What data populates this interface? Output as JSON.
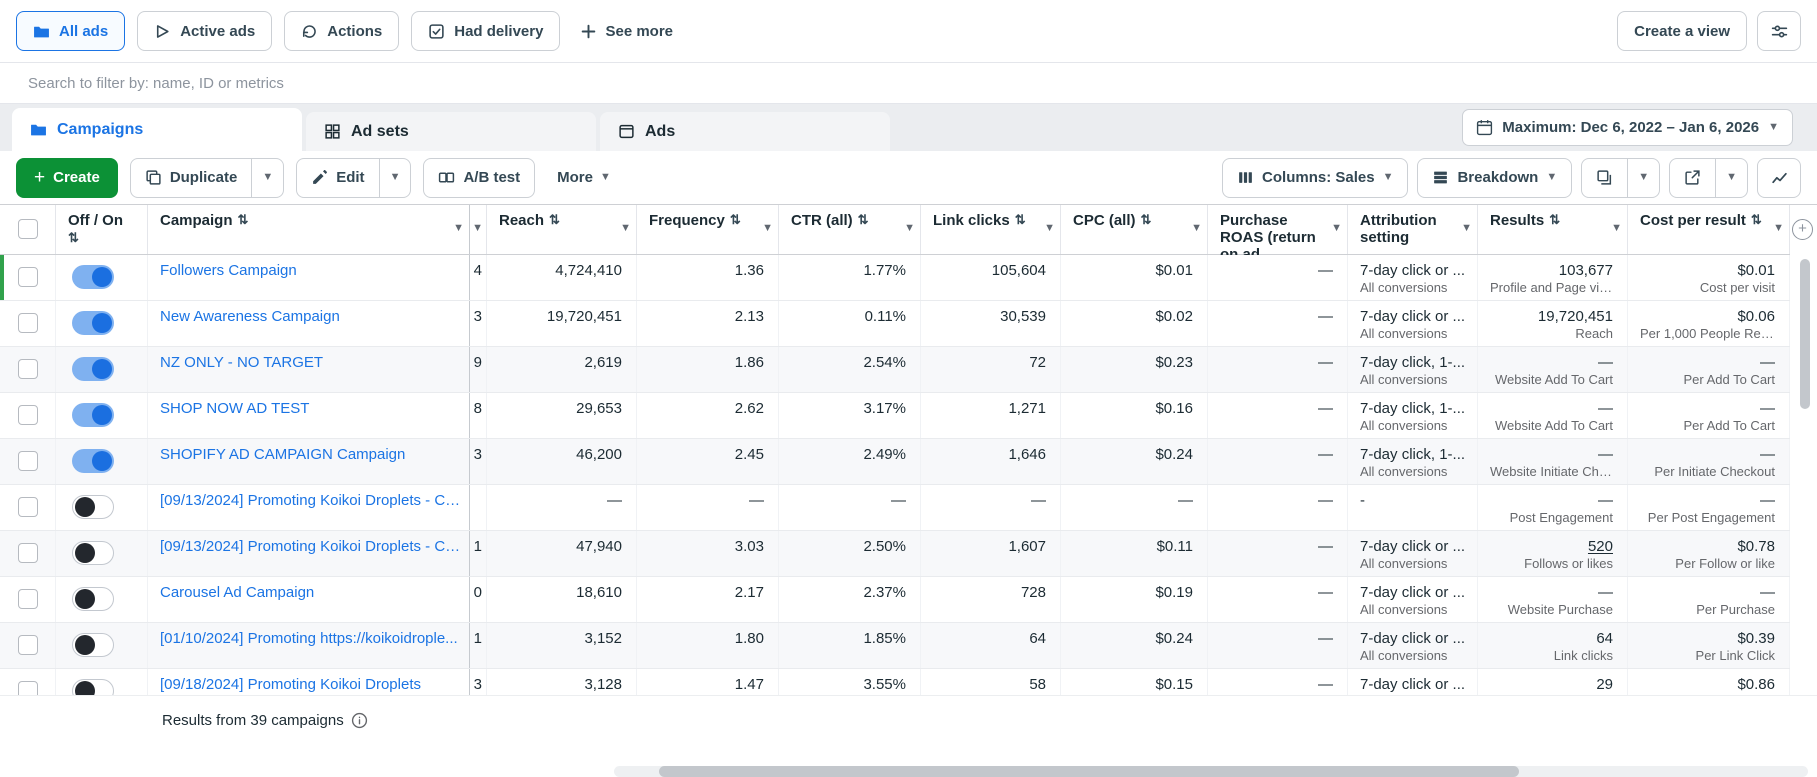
{
  "colors": {
    "accent_blue": "#1b74e4",
    "create_green": "#0c9136",
    "link_blue": "#1b74e4",
    "indicator_green": "#31a24c"
  },
  "filter_bar": {
    "pills": [
      {
        "label": "All ads",
        "selected": true
      },
      {
        "label": "Active ads",
        "selected": false
      },
      {
        "label": "Actions",
        "selected": false
      },
      {
        "label": "Had delivery",
        "selected": false
      }
    ],
    "see_more": "See more",
    "create_view": "Create a view"
  },
  "search": {
    "placeholder": "Search to filter by: name, ID or metrics"
  },
  "tabs": [
    {
      "label": "Campaigns",
      "active": true
    },
    {
      "label": "Ad sets",
      "active": false
    },
    {
      "label": "Ads",
      "active": false
    }
  ],
  "date_range": {
    "label": "Maximum: Dec 6, 2022 – Jan 6, 2026"
  },
  "toolbar": {
    "create": "Create",
    "duplicate": "Duplicate",
    "edit": "Edit",
    "ab_test": "A/B test",
    "more": "More",
    "columns": "Columns: Sales",
    "breakdown": "Breakdown"
  },
  "table": {
    "headers": {
      "off_on": "Off / On",
      "campaign": "Campaign",
      "reach": "Reach",
      "frequency": "Frequency",
      "ctr": "CTR (all)",
      "link_clicks": "Link clicks",
      "cpc": "CPC (all)",
      "purchase_roas": "Purchase ROAS (return on ad...",
      "attribution": "Attribution setting",
      "results": "Results",
      "cost_per_result": "Cost per result"
    },
    "rows": [
      {
        "name": "Followers Campaign",
        "on": true,
        "updated": true,
        "frag": "4",
        "reach": "4,724,410",
        "frequency": "1.36",
        "ctr": "1.77%",
        "link_clicks": "105,604",
        "cpc": "$0.01",
        "roas": "—",
        "attribution": "7-day click or ...",
        "attribution_sub": "All conversions",
        "results": "103,677",
        "results_sub": "Profile and Page visits",
        "cost": "$0.01",
        "cost_sub": "Cost per visit"
      },
      {
        "name": "New Awareness Campaign",
        "on": true,
        "frag": "3",
        "reach": "19,720,451",
        "frequency": "2.13",
        "ctr": "0.11%",
        "link_clicks": "30,539",
        "cpc": "$0.02",
        "roas": "—",
        "attribution": "7-day click or ...",
        "attribution_sub": "All conversions",
        "results": "19,720,451",
        "results_sub": "Reach",
        "cost": "$0.06",
        "cost_sub": "Per 1,000 People Rea..."
      },
      {
        "name": "NZ ONLY - NO TARGET",
        "on": true,
        "frag": "9",
        "reach": "2,619",
        "frequency": "1.86",
        "ctr": "2.54%",
        "link_clicks": "72",
        "cpc": "$0.23",
        "roas": "—",
        "attribution": "7-day click, 1-...",
        "attribution_sub": "All conversions",
        "results": "—",
        "results_sub": "Website Add To Cart",
        "cost": "—",
        "cost_sub": "Per Add To Cart"
      },
      {
        "name": "SHOP NOW AD TEST",
        "on": true,
        "frag": "8",
        "reach": "29,653",
        "frequency": "2.62",
        "ctr": "3.17%",
        "link_clicks": "1,271",
        "cpc": "$0.16",
        "roas": "—",
        "attribution": "7-day click, 1-...",
        "attribution_sub": "All conversions",
        "results": "—",
        "results_sub": "Website Add To Cart",
        "cost": "—",
        "cost_sub": "Per Add To Cart"
      },
      {
        "name": "SHOPIFY AD CAMPAIGN Campaign",
        "on": true,
        "frag": "3",
        "reach": "46,200",
        "frequency": "2.45",
        "ctr": "2.49%",
        "link_clicks": "1,646",
        "cpc": "$0.24",
        "roas": "—",
        "attribution": "7-day click, 1-...",
        "attribution_sub": "All conversions",
        "results": "—",
        "results_sub": "Website Initiate Chec...",
        "cost": "—",
        "cost_sub": "Per Initiate Checkout"
      },
      {
        "name": "[09/13/2024] Promoting Koikoi Droplets - Co...",
        "on": false,
        "frag": "",
        "reach": "—",
        "frequency": "—",
        "ctr": "—",
        "link_clicks": "—",
        "cpc": "—",
        "roas": "—",
        "attribution": "-",
        "attribution_sub": "",
        "results": "—",
        "results_sub": "Post Engagement",
        "cost": "—",
        "cost_sub": "Per Post Engagement"
      },
      {
        "name": "[09/13/2024] Promoting Koikoi Droplets - Co...",
        "on": false,
        "frag": "1",
        "reach": "47,940",
        "frequency": "3.03",
        "ctr": "2.50%",
        "link_clicks": "1,607",
        "cpc": "$0.11",
        "roas": "—",
        "attribution": "7-day click or ...",
        "attribution_sub": "All conversions",
        "results": "520",
        "results_link": true,
        "results_sub": "Follows or likes",
        "cost": "$0.78",
        "cost_sub": "Per Follow or like"
      },
      {
        "name": "Carousel Ad Campaign",
        "on": false,
        "frag": "0",
        "reach": "18,610",
        "frequency": "2.17",
        "ctr": "2.37%",
        "link_clicks": "728",
        "cpc": "$0.19",
        "roas": "—",
        "attribution": "7-day click or ...",
        "attribution_sub": "All conversions",
        "results": "—",
        "results_sub": "Website Purchase",
        "cost": "—",
        "cost_sub": "Per Purchase"
      },
      {
        "name": "[01/10/2024] Promoting https://koikoidrople...",
        "on": false,
        "frag": "1",
        "reach": "3,152",
        "frequency": "1.80",
        "ctr": "1.85%",
        "link_clicks": "64",
        "cpc": "$0.24",
        "roas": "—",
        "attribution": "7-day click or ...",
        "attribution_sub": "All conversions",
        "results": "64",
        "results_sub": "Link clicks",
        "cost": "$0.39",
        "cost_sub": "Per Link Click"
      },
      {
        "name": "[09/18/2024] Promoting Koikoi Droplets",
        "on": false,
        "frag": "3",
        "reach": "3,128",
        "frequency": "1.47",
        "ctr": "3.55%",
        "link_clicks": "58",
        "cpc": "$0.15",
        "roas": "—",
        "attribution": "7-day click or ...",
        "attribution_sub": "",
        "results": "29",
        "results_sub": "",
        "cost": "$0.86",
        "cost_sub": ""
      }
    ]
  },
  "footer": {
    "results_text": "Results from 39 campaigns"
  }
}
